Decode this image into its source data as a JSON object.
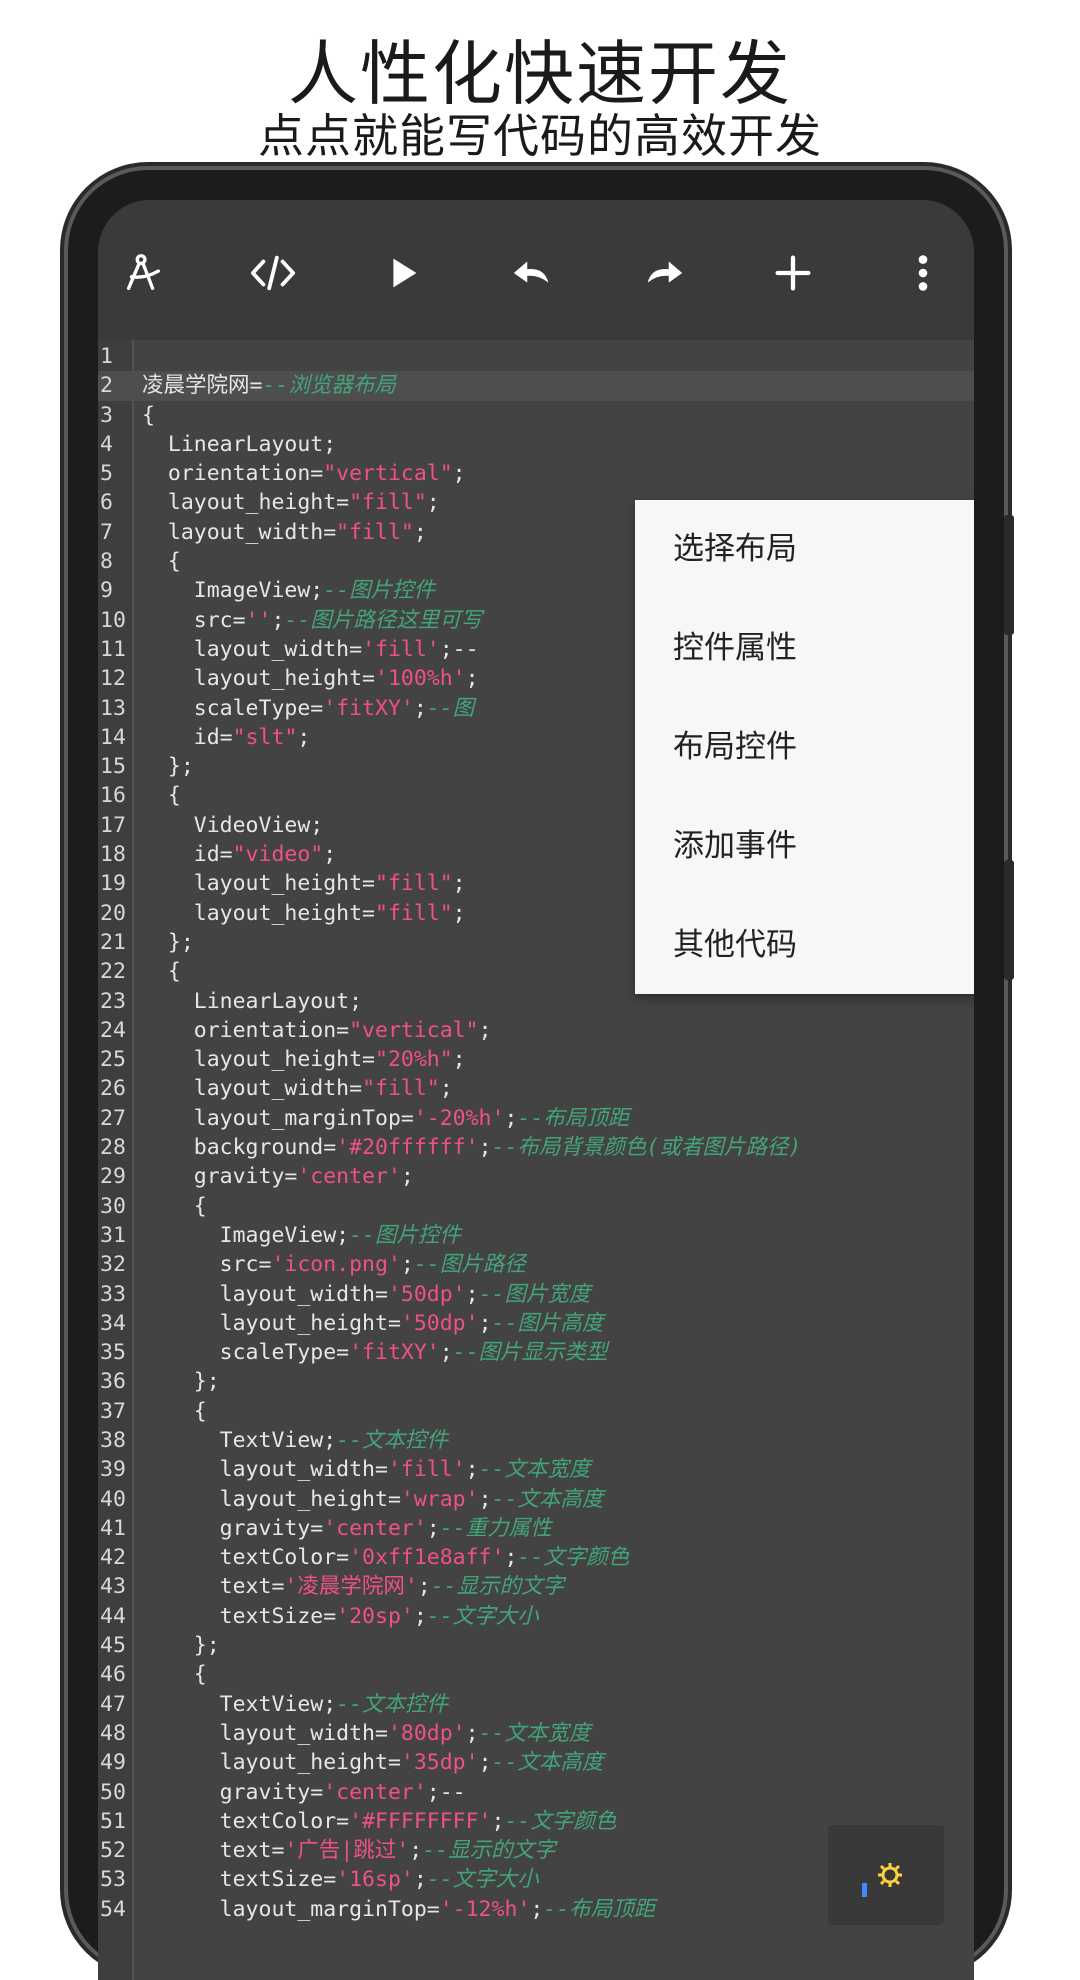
{
  "promo": {
    "title": "人性化快速开发",
    "subtitle": "点点就能写代码的高效开发"
  },
  "toolbar": {
    "buttons": [
      {
        "icon": "compass-icon"
      },
      {
        "icon": "code-icon"
      },
      {
        "icon": "play-icon"
      },
      {
        "icon": "undo-icon"
      },
      {
        "icon": "redo-icon"
      },
      {
        "icon": "plus-icon"
      },
      {
        "icon": "more-vertical-icon"
      }
    ]
  },
  "menu": {
    "items": [
      "选择布局",
      "控件属性",
      "布局控件",
      "添加事件",
      "其他代码"
    ]
  },
  "editor": {
    "current_line": 2,
    "lines": [
      [
        {
          "t": ""
        }
      ],
      [
        {
          "t": "凌晨学院网="
        },
        {
          "t": "--浏览器布局",
          "k": "c"
        }
      ],
      [
        {
          "t": "{"
        }
      ],
      [
        {
          "t": "  LinearLayout;"
        }
      ],
      [
        {
          "t": "  orientation="
        },
        {
          "t": "\"vertical\"",
          "k": "s"
        },
        {
          "t": ";"
        }
      ],
      [
        {
          "t": "  layout_height="
        },
        {
          "t": "\"fill\"",
          "k": "s"
        },
        {
          "t": ";"
        }
      ],
      [
        {
          "t": "  layout_width="
        },
        {
          "t": "\"fill\"",
          "k": "s"
        },
        {
          "t": ";"
        }
      ],
      [
        {
          "t": "  {"
        }
      ],
      [
        {
          "t": "    ImageView;"
        },
        {
          "t": "--图片控件",
          "k": "c"
        }
      ],
      [
        {
          "t": "    src="
        },
        {
          "t": "''",
          "k": "s"
        },
        {
          "t": ";"
        },
        {
          "t": "--图片路径这里可写",
          "k": "c"
        }
      ],
      [
        {
          "t": "    layout_width="
        },
        {
          "t": "'fill'",
          "k": "s"
        },
        {
          "t": ";--"
        }
      ],
      [
        {
          "t": "    layout_height="
        },
        {
          "t": "'100%h'",
          "k": "s"
        },
        {
          "t": ";"
        }
      ],
      [
        {
          "t": "    scaleType="
        },
        {
          "t": "'fitXY'",
          "k": "s"
        },
        {
          "t": ";"
        },
        {
          "t": "--图",
          "k": "c"
        }
      ],
      [
        {
          "t": "    id="
        },
        {
          "t": "\"slt\"",
          "k": "s"
        },
        {
          "t": ";"
        }
      ],
      [
        {
          "t": "  };"
        }
      ],
      [
        {
          "t": "  {"
        }
      ],
      [
        {
          "t": "    VideoView;"
        }
      ],
      [
        {
          "t": "    id="
        },
        {
          "t": "\"video\"",
          "k": "s"
        },
        {
          "t": ";"
        }
      ],
      [
        {
          "t": "    layout_height="
        },
        {
          "t": "\"fill\"",
          "k": "s"
        },
        {
          "t": ";"
        }
      ],
      [
        {
          "t": "    layout_height="
        },
        {
          "t": "\"fill\"",
          "k": "s"
        },
        {
          "t": ";"
        }
      ],
      [
        {
          "t": "  };"
        }
      ],
      [
        {
          "t": "  {"
        }
      ],
      [
        {
          "t": "    LinearLayout;"
        }
      ],
      [
        {
          "t": "    orientation="
        },
        {
          "t": "\"vertical\"",
          "k": "s"
        },
        {
          "t": ";"
        }
      ],
      [
        {
          "t": "    layout_height="
        },
        {
          "t": "\"20%h\"",
          "k": "s"
        },
        {
          "t": ";"
        }
      ],
      [
        {
          "t": "    layout_width="
        },
        {
          "t": "\"fill\"",
          "k": "s"
        },
        {
          "t": ";"
        }
      ],
      [
        {
          "t": "    layout_marginTop="
        },
        {
          "t": "'-20%h'",
          "k": "s"
        },
        {
          "t": ";"
        },
        {
          "t": "--布局顶距",
          "k": "c"
        }
      ],
      [
        {
          "t": "    background="
        },
        {
          "t": "'#20ffffff'",
          "k": "s"
        },
        {
          "t": ";"
        },
        {
          "t": "--布局背景颜色(或者图片路径)",
          "k": "c"
        }
      ],
      [
        {
          "t": "    gravity="
        },
        {
          "t": "'center'",
          "k": "s"
        },
        {
          "t": ";"
        }
      ],
      [
        {
          "t": "    {"
        }
      ],
      [
        {
          "t": "      ImageView;"
        },
        {
          "t": "--图片控件",
          "k": "c"
        }
      ],
      [
        {
          "t": "      src="
        },
        {
          "t": "'icon.png'",
          "k": "s"
        },
        {
          "t": ";"
        },
        {
          "t": "--图片路径",
          "k": "c"
        }
      ],
      [
        {
          "t": "      layout_width="
        },
        {
          "t": "'50dp'",
          "k": "s"
        },
        {
          "t": ";"
        },
        {
          "t": "--图片宽度",
          "k": "c"
        }
      ],
      [
        {
          "t": "      layout_height="
        },
        {
          "t": "'50dp'",
          "k": "s"
        },
        {
          "t": ";"
        },
        {
          "t": "--图片高度",
          "k": "c"
        }
      ],
      [
        {
          "t": "      scaleType="
        },
        {
          "t": "'fitXY'",
          "k": "s"
        },
        {
          "t": ";"
        },
        {
          "t": "--图片显示类型",
          "k": "c"
        }
      ],
      [
        {
          "t": "    };"
        }
      ],
      [
        {
          "t": "    {"
        }
      ],
      [
        {
          "t": "      TextView;"
        },
        {
          "t": "--文本控件",
          "k": "c"
        }
      ],
      [
        {
          "t": "      layout_width="
        },
        {
          "t": "'fill'",
          "k": "s"
        },
        {
          "t": ";"
        },
        {
          "t": "--文本宽度",
          "k": "c"
        }
      ],
      [
        {
          "t": "      layout_height="
        },
        {
          "t": "'wrap'",
          "k": "s"
        },
        {
          "t": ";"
        },
        {
          "t": "--文本高度",
          "k": "c"
        }
      ],
      [
        {
          "t": "      gravity="
        },
        {
          "t": "'center'",
          "k": "s"
        },
        {
          "t": ";"
        },
        {
          "t": "--重力属性",
          "k": "c"
        }
      ],
      [
        {
          "t": "      textColor="
        },
        {
          "t": "'0xff1e8aff'",
          "k": "s"
        },
        {
          "t": ";"
        },
        {
          "t": "--文字颜色",
          "k": "c"
        }
      ],
      [
        {
          "t": "      text="
        },
        {
          "t": "'凌晨学院网'",
          "k": "s"
        },
        {
          "t": ";"
        },
        {
          "t": "--显示的文字",
          "k": "c"
        }
      ],
      [
        {
          "t": "      textSize="
        },
        {
          "t": "'20sp'",
          "k": "s"
        },
        {
          "t": ";"
        },
        {
          "t": "--文字大小",
          "k": "c"
        }
      ],
      [
        {
          "t": "    };"
        }
      ],
      [
        {
          "t": "    {"
        }
      ],
      [
        {
          "t": "      TextView;"
        },
        {
          "t": "--文本控件",
          "k": "c"
        }
      ],
      [
        {
          "t": "      layout_width="
        },
        {
          "t": "'80dp'",
          "k": "s"
        },
        {
          "t": ";"
        },
        {
          "t": "--文本宽度",
          "k": "c"
        }
      ],
      [
        {
          "t": "      layout_height="
        },
        {
          "t": "'35dp'",
          "k": "s"
        },
        {
          "t": ";"
        },
        {
          "t": "--文本高度",
          "k": "c"
        }
      ],
      [
        {
          "t": "      gravity="
        },
        {
          "t": "'center'",
          "k": "s"
        },
        {
          "t": ";--"
        }
      ],
      [
        {
          "t": "      textColor="
        },
        {
          "t": "'#FFFFFFFF'",
          "k": "s"
        },
        {
          "t": ";"
        },
        {
          "t": "--文字颜色",
          "k": "c"
        }
      ],
      [
        {
          "t": "      text="
        },
        {
          "t": "'广告|跳过'",
          "k": "s"
        },
        {
          "t": ";"
        },
        {
          "t": "--显示的文字",
          "k": "c"
        }
      ],
      [
        {
          "t": "      textSize="
        },
        {
          "t": "'16sp'",
          "k": "s"
        },
        {
          "t": ";"
        },
        {
          "t": "--文字大小",
          "k": "c"
        }
      ],
      [
        {
          "t": "      layout_marginTop="
        },
        {
          "t": "'-12%h'",
          "k": "s"
        },
        {
          "t": ";"
        },
        {
          "t": "--布局顶距",
          "k": "c"
        }
      ]
    ]
  },
  "fab": {
    "icon": "settings-icon"
  },
  "colors": {
    "editor_bg": "#434343",
    "string": "#f0508a",
    "comment": "#43a47a",
    "text": "#e6e6e6",
    "menu_bg": "#f7f7f7"
  }
}
